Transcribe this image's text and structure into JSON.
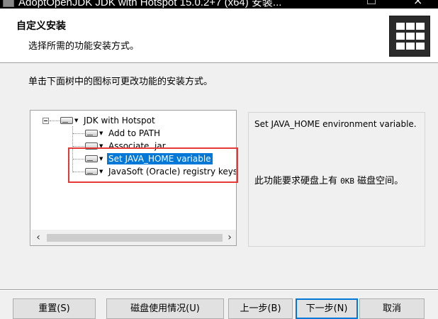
{
  "window": {
    "title": "AdoptOpenJDK JDK with Hotspot 15.0.2+7 (x64) 安装..."
  },
  "banner": {
    "title": "自定义安装",
    "subtitle": "选择所需的功能安装方式。"
  },
  "instruction": "单击下面树中的图标可更改功能的安装方式。",
  "tree": {
    "root": {
      "label": "JDK with Hotspot"
    },
    "items": [
      {
        "label": "Add to PATH",
        "selected": false
      },
      {
        "label": "Associate .jar",
        "selected": false
      },
      {
        "label": "Set JAVA_HOME variable",
        "selected": true
      },
      {
        "label": "JavaSoft (Oracle) registry keys",
        "selected": false
      }
    ],
    "scroll_left": "‹",
    "scroll_right": "›"
  },
  "description": {
    "text": "Set JAVA_HOME environment variable.",
    "space_prefix": "此功能要求硬盘上有 ",
    "space_size": "0KB",
    "space_suffix": " 磁盘空间。"
  },
  "buttons": {
    "reset": "重置(S)",
    "disk_usage": "磁盘使用情况(U)",
    "back": "上一步(B)",
    "next": "下一步(N)",
    "cancel": "取消"
  },
  "colors": {
    "selection": "#0078d7",
    "highlight_box": "#e53935"
  }
}
